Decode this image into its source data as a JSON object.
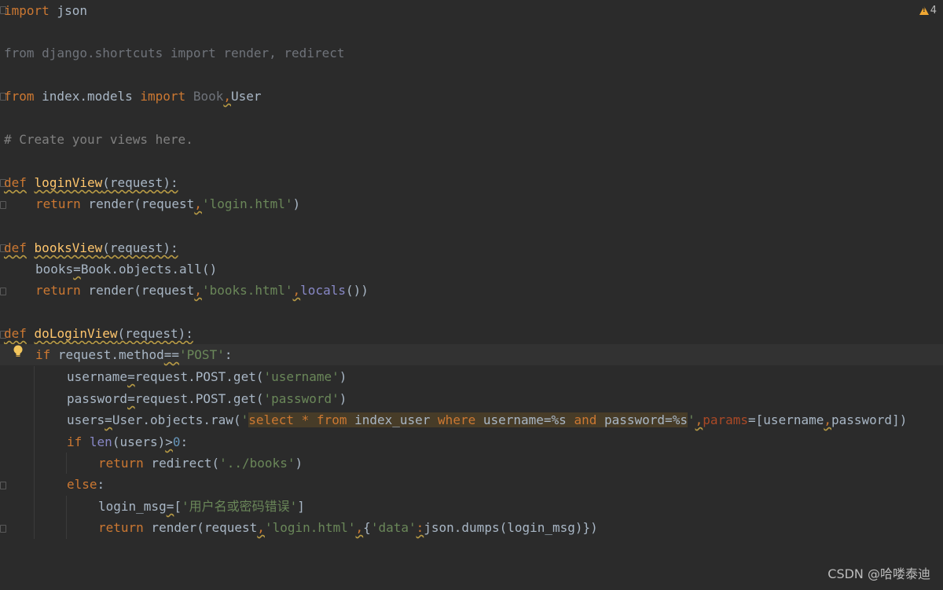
{
  "editor": {
    "warning_count": "4",
    "lines": {
      "l1": {
        "a": "import",
        "b": " json"
      },
      "l2": {
        "text": "from django.shortcuts import render, redirect"
      },
      "l3": {
        "a": "from",
        "b": " index.models ",
        "c": "import",
        "d": " Book",
        "e": ",",
        "f": "User"
      },
      "l4": {
        "text": "# Create your views here."
      },
      "l5": {
        "a": "def",
        "b": " ",
        "c": "loginView",
        "d": "(request):"
      },
      "l6": {
        "a": "return",
        "b": " render(request",
        "c": ",",
        "d": "'login.html'",
        "e": ")"
      },
      "l7": {
        "a": "def",
        "b": " ",
        "c": "booksView",
        "d": "(request):"
      },
      "l8": {
        "a": "books",
        "b": "=",
        "c": "Book.objects.all()"
      },
      "l9": {
        "a": "return",
        "b": " render(request",
        "c": ",",
        "d": "'books.html'",
        "e": ",",
        "f": "locals",
        "g": "())"
      },
      "l10": {
        "a": "def",
        "b": " ",
        "c": "doLoginView",
        "d": "(request):"
      },
      "l11": {
        "a": "if",
        "b": " request.method",
        "c": "==",
        "d": "'POST'",
        "e": ":"
      },
      "l12": {
        "a": "username",
        "b": "=",
        "c": "request.POST.get(",
        "d": "'username'",
        "e": ")"
      },
      "l13": {
        "a": "password",
        "b": "=",
        "c": "request.POST.get(",
        "d": "'password'",
        "e": ")"
      },
      "l14": {
        "a": "users",
        "b": "=",
        "c": "User.objects.raw(",
        "d": "'",
        "s1": "select",
        "s2": " * ",
        "s3": "from",
        "s4": " index_user ",
        "s5": "where",
        "s6": " username=%s ",
        "s7": "and",
        "s8": " password=%s",
        "e": "'",
        "f": ",",
        "g": "params",
        "h": "=[username",
        "i": ",",
        "j": "password])"
      },
      "l15": {
        "a": "if",
        "b": " ",
        "c": "len",
        "d": "(users)",
        "e": ">",
        "f": "0",
        "g": ":"
      },
      "l16": {
        "a": "return",
        "b": " redirect(",
        "c": "'../books'",
        "d": ")"
      },
      "l17": {
        "a": "else",
        "b": ":"
      },
      "l18": {
        "a": "login_msg",
        "b": "=",
        "c": "[",
        "d": "'用户名或密码错误'",
        "e": "]"
      },
      "l19": {
        "a": "return",
        "b": " render(request",
        "c": ",",
        "d": "'login.html'",
        "e": ",",
        "f": "{",
        "g": "'data'",
        "h": ":",
        "i": "json.dumps(login_msg)})"
      }
    }
  },
  "watermark": "CSDN @哈喽泰迪",
  "colors": {
    "background": "#2b2b2b",
    "keyword": "#cc7832",
    "string": "#6a8759",
    "comment": "#808080",
    "function": "#ffc66d",
    "builtin": "#8888c6",
    "number": "#6897bb",
    "default": "#a9b7c6",
    "warning": "#f0a732"
  },
  "icons": [
    "warning-icon",
    "lightbulb-icon",
    "fold-marker-icon"
  ]
}
